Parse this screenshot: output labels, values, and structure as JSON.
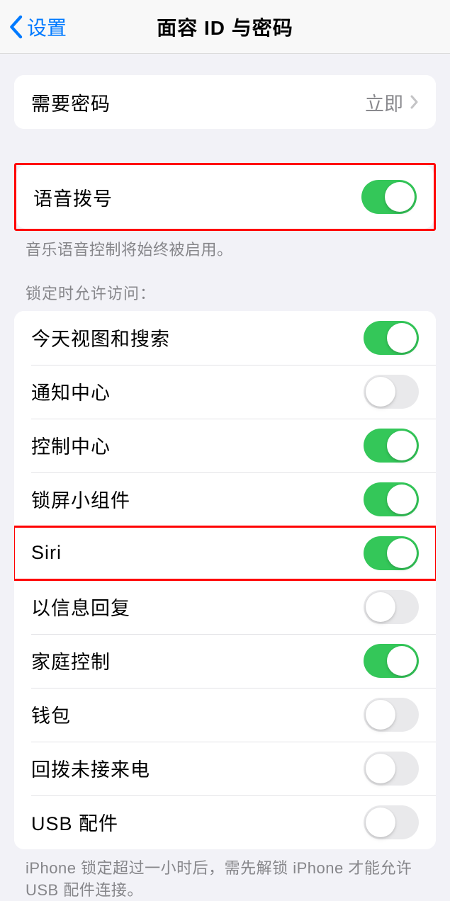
{
  "nav": {
    "back_label": "设置",
    "title": "面容 ID 与密码"
  },
  "require_passcode": {
    "label": "需要密码",
    "value": "立即"
  },
  "voice_dial": {
    "label": "语音拨号",
    "on": true,
    "footer": "音乐语音控制将始终被启用。"
  },
  "lock_section": {
    "header": "锁定时允许访问：",
    "items": [
      {
        "label": "今天视图和搜索",
        "on": true
      },
      {
        "label": "通知中心",
        "on": false
      },
      {
        "label": "控制中心",
        "on": true
      },
      {
        "label": "锁屏小组件",
        "on": true
      },
      {
        "label": "Siri",
        "on": true
      },
      {
        "label": "以信息回复",
        "on": false
      },
      {
        "label": "家庭控制",
        "on": true
      },
      {
        "label": "钱包",
        "on": false
      },
      {
        "label": "回拨未接来电",
        "on": false
      },
      {
        "label": "USB 配件",
        "on": false
      }
    ],
    "footer": "iPhone 锁定超过一小时后，需先解锁 iPhone 才能允许USB 配件连接。"
  }
}
